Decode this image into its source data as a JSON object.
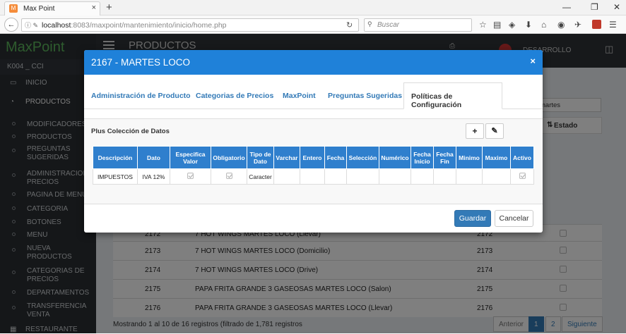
{
  "browser": {
    "tab_title": "Max Point",
    "url_host": "localhost",
    "url_rest": ":8083/maxpoint/mantenimiento/inicio/home.php",
    "search_placeholder": "Buscar"
  },
  "app": {
    "logo": "MaxPoint",
    "store": "K004 _ CCI",
    "header_title": "PRODUCTOS",
    "user": "DESARROLLO",
    "sidebar": {
      "items": [
        {
          "label": "INICIO"
        },
        {
          "label": "PRODUCTOS"
        }
      ],
      "subitems": [
        "MODIFICADORES",
        "PRODUCTOS",
        "PREGUNTAS",
        "SUGERIDAS",
        "ADMINISTRACION",
        "PRECIOS",
        "PAGINA DE MENU",
        "CATEGORIA",
        "BOTONES",
        "MENU",
        "NUEVA",
        "PRODUCTOS",
        "CATEGORIAS DE",
        "PRECIOS",
        "DEPARTAMENTOS",
        "TRANSFERENCIA",
        "VENTA"
      ],
      "bottom": "RESTAURANTE"
    },
    "search_value": "martes",
    "estado_header": "Estado",
    "rows": [
      {
        "code": "2172",
        "name": "7 HOT WINGS MARTES LOCO (Llevar)",
        "code2": "2172"
      },
      {
        "code": "2173",
        "name": "7 HOT WINGS MARTES LOCO (Domicilio)",
        "code2": "2173"
      },
      {
        "code": "2174",
        "name": "7 HOT WINGS MARTES LOCO (Drive)",
        "code2": "2174"
      },
      {
        "code": "2175",
        "name": "PAPA FRITA GRANDE 3 GASEOSAS MARTES LOCO (Salon)",
        "code2": "2175"
      },
      {
        "code": "2176",
        "name": "PAPA FRITA GRANDE 3 GASEOSAS MARTES LOCO (Llevar)",
        "code2": "2176"
      }
    ],
    "footer": "Mostrando 1 al 10 de 16 registros (filtrado de 1,781 registros",
    "pager": {
      "prev": "Anterior",
      "p1": "1",
      "p2": "2",
      "next": "Siguiente"
    }
  },
  "modal": {
    "title": "2167 - MARTES LOCO",
    "tabs": [
      "Administración de Producto",
      "Categorias de Precios",
      "MaxPoint",
      "Preguntas Sugeridas",
      "Políticas de Configuración"
    ],
    "panel_title": "Plus Colección de Datos",
    "columns": [
      "Descripción",
      "Dato",
      "Especifica Valor",
      "Obligatorio",
      "Tipo de Dato",
      "Varchar",
      "Entero",
      "Fecha",
      "Selección",
      "Numérico",
      "Fecha Inicio",
      "Fecha Fin",
      "Minimo",
      "Maximo",
      "Activo"
    ],
    "row": {
      "descripcion": "IMPUESTOS",
      "dato": "IVA 12%",
      "tipo": "Caracter"
    },
    "save": "Guardar",
    "cancel": "Cancelar"
  }
}
